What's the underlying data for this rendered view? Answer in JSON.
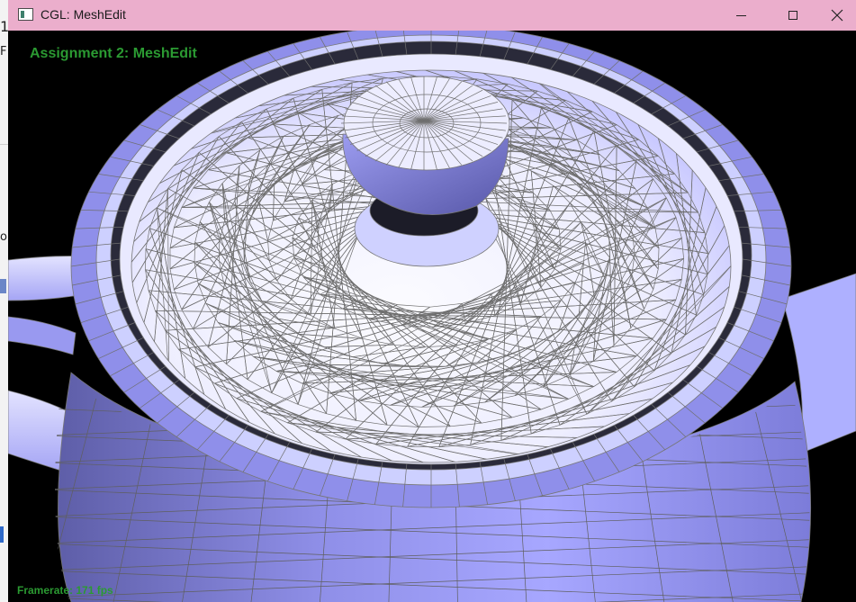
{
  "window": {
    "title": "CGL: MeshEdit",
    "titlebar_color": "#ebaecc",
    "controls": [
      "minimize-icon",
      "maximize-icon",
      "close-icon"
    ]
  },
  "background_window": {
    "visible_chars": [
      "1",
      "F",
      "o"
    ]
  },
  "viewer": {
    "hud_title": "Assignment 2: MeshEdit",
    "framerate": "Framerate: 171 fps",
    "hud_color": "#2b9a32",
    "background": "#000000",
    "mesh_fill": "#9d9dff",
    "mesh_highlight": "#f4f4ff",
    "wire_color": "#6f6f6f"
  }
}
